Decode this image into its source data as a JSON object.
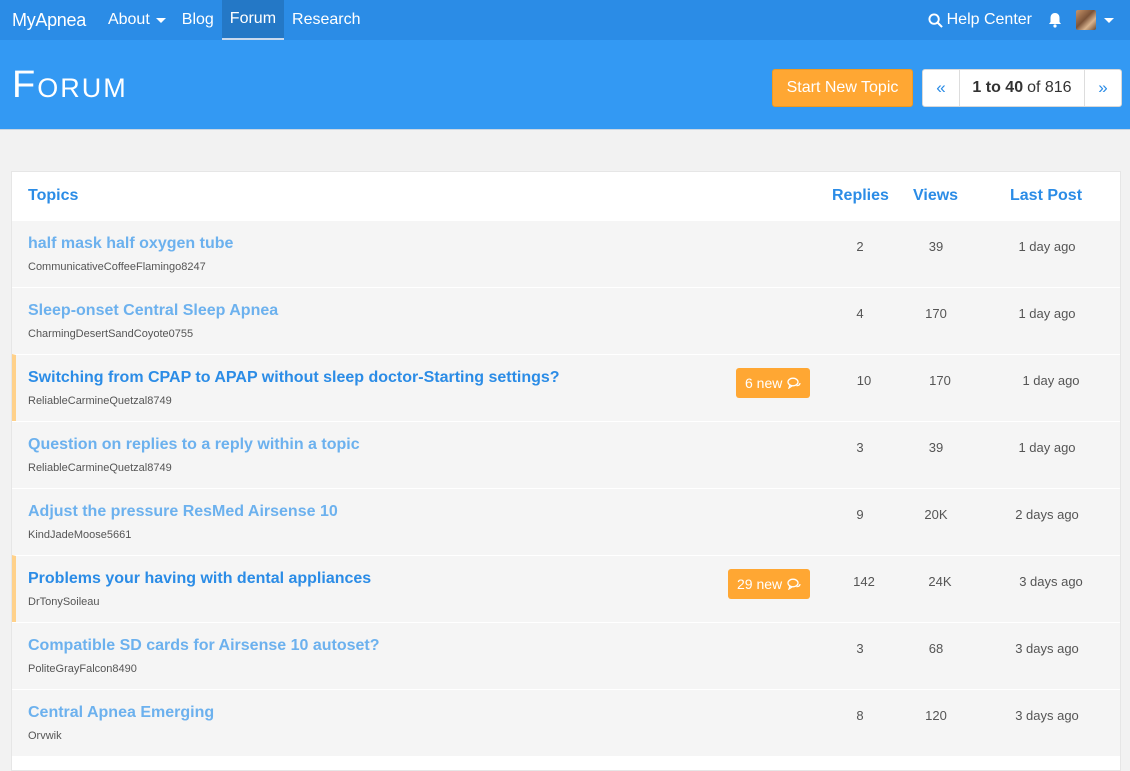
{
  "nav": {
    "brand": "MyApnea",
    "items": [
      "About",
      "Blog",
      "Forum",
      "Research"
    ],
    "help": "Help Center"
  },
  "header": {
    "title": "Forum",
    "start_topic": "Start New Topic",
    "pager": {
      "prev": "«",
      "range": "1 to 40",
      "of": "of 816",
      "next": "»"
    }
  },
  "table": {
    "headers": {
      "topics": "Topics",
      "replies": "Replies",
      "views": "Views",
      "last_post": "Last Post"
    },
    "rows": [
      {
        "title": "half mask half oxygen tube",
        "author": "CommunicativeCoffeeFlamingo8247",
        "replies": "2",
        "views": "39",
        "last": "1 day ago",
        "new": ""
      },
      {
        "title": "Sleep-onset Central Sleep Apnea",
        "author": "CharmingDesertSandCoyote0755",
        "replies": "4",
        "views": "170",
        "last": "1 day ago",
        "new": ""
      },
      {
        "title": "Switching from CPAP to APAP without sleep doctor-Starting settings?",
        "author": "ReliableCarmineQuetzal8749",
        "replies": "10",
        "views": "170",
        "last": "1 day ago",
        "new": "6 new"
      },
      {
        "title": "Question on replies to a reply within a topic",
        "author": "ReliableCarmineQuetzal8749",
        "replies": "3",
        "views": "39",
        "last": "1 day ago",
        "new": ""
      },
      {
        "title": "Adjust the pressure ResMed Airsense 10",
        "author": "KindJadeMoose5661",
        "replies": "9",
        "views": "20K",
        "last": "2 days ago",
        "new": ""
      },
      {
        "title": "Problems your having with dental appliances",
        "author": "DrTonySoileau",
        "replies": "142",
        "views": "24K",
        "last": "3 days ago",
        "new": "29 new"
      },
      {
        "title": "Compatible SD cards for Airsense 10 autoset?",
        "author": "PoliteGrayFalcon8490",
        "replies": "3",
        "views": "68",
        "last": "3 days ago",
        "new": ""
      },
      {
        "title": "Central Apnea Emerging",
        "author": "Orvwik",
        "replies": "8",
        "views": "120",
        "last": "3 days ago",
        "new": ""
      }
    ]
  },
  "colors": {
    "nav": "#2b8ce6",
    "header": "#3399f3",
    "accent": "#ffa733"
  }
}
